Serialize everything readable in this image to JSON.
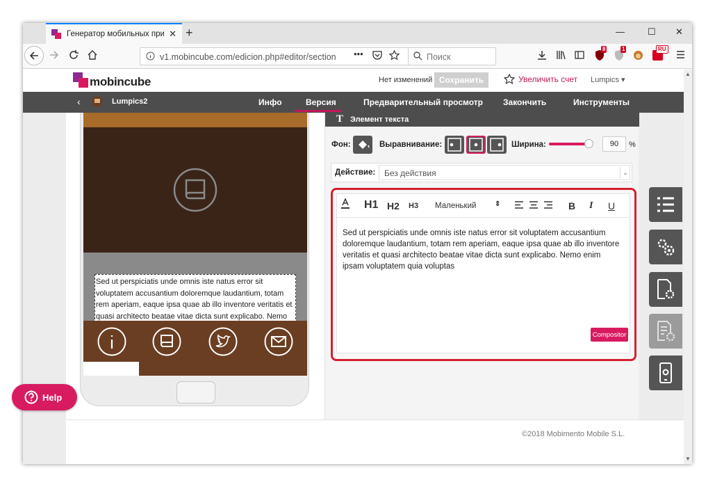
{
  "browser": {
    "tab_title": "Генератор мобильных прило",
    "url": "v1.mobincube.com/edicion.php#editor/section",
    "search_placeholder": "Поиск",
    "badge_1": "8",
    "badge_2": "1",
    "badge_3": "RU"
  },
  "site": {
    "logo": "mobincube",
    "status": "Нет изменений",
    "save_label": "Сохранить",
    "upgrade_label": "Увеличить счет",
    "account": "Lumpics"
  },
  "menu": {
    "project": "Lumpics2",
    "items": [
      "Инфо",
      "Версия",
      "Предварительный просмотр",
      "Закончить",
      "Инструменты"
    ],
    "active": "Версия"
  },
  "phone": {
    "preview_text": "Sed ut perspiciatis unde omnis iste natus error sit voluptatem accusantium doloremque laudantium, totam rem aperiam, eaque ipsa quae ab illo inventore veritatis et quasi architecto beatae vitae dicta sunt explicabo. Nemo",
    "nav_icons": [
      "info-icon",
      "book-icon",
      "twitter-icon",
      "mail-icon"
    ]
  },
  "editor": {
    "title": "Элемент текста",
    "background_label": "Фон:",
    "align_label": "Выравнивание:",
    "width_label": "Ширина:",
    "width_value": "90",
    "width_unit": "%",
    "action_label": "Действие:",
    "action_value": "Без действия",
    "toolbar": {
      "h1": "H1",
      "h2": "H2",
      "h3": "H3",
      "size": "Маленький",
      "bold": "B",
      "italic": "I",
      "underline": "U"
    },
    "text": "Sed ut perspiciatis unde omnis iste natus error sit voluptatem accusantium doloremque laudantium, totam rem aperiam, eaque ipsa quae ab illo inventore veritatis et quasi architecto beatae vitae dicta sunt explicabo. Nemo enim ipsam voluptatem quia voluptas",
    "composer_label": "Compositor"
  },
  "footer": {
    "help_label": "Help",
    "copyright": "©2018 Mobimento Mobile S.L."
  },
  "colors": {
    "accent": "#d81b60",
    "menu_bg": "#4d4d4d",
    "highlight_frame": "#d3202f",
    "phone_header": "#3a2418",
    "phone_strip": "#a86b2a",
    "phone_bottom": "#6a3e22"
  }
}
